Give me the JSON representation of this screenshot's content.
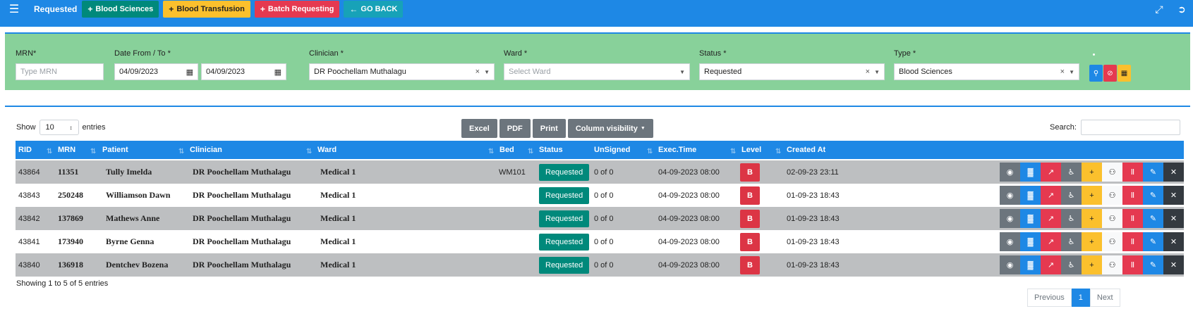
{
  "topbar": {
    "menu_icon": "hamburger-icon",
    "crumb": "Requested",
    "buttons": [
      {
        "label": "Blood Sciences",
        "icon": "plus-icon"
      },
      {
        "label": "Blood Transfusion",
        "icon": "plus-icon"
      },
      {
        "label": "Batch Requesting",
        "icon": "plus-icon"
      },
      {
        "label": "GO BACK",
        "icon": "arrow-left-icon"
      }
    ],
    "right_icons": [
      "expand-icon",
      "logout-icon"
    ]
  },
  "filters": {
    "mrn": {
      "label": "MRN*",
      "placeholder": "Type MRN"
    },
    "date": {
      "label": "Date From / To *",
      "from": "04/09/2023",
      "to": "04/09/2023"
    },
    "clinician": {
      "label": "Clinician *",
      "value": "DR Poochellam Muthalagu"
    },
    "ward": {
      "label": "Ward *",
      "placeholder": "Select Ward"
    },
    "status": {
      "label": "Status *",
      "value": "Requested"
    },
    "type": {
      "label": "Type *",
      "value": "Blood Sciences"
    },
    "action_colors": {
      "search": "#1e88e5",
      "clear": "#e53950",
      "calendar": "#fbc02d"
    }
  },
  "table": {
    "show_label": "Show",
    "entries_value": "10",
    "entries_label": "entries",
    "export_buttons": [
      "Excel",
      "PDF",
      "Print",
      "Column visibility"
    ],
    "search_label": "Search:",
    "columns": [
      "RID",
      "MRN",
      "Patient",
      "Clinician",
      "Ward",
      "Bed",
      "Status",
      "UnSigned",
      "Exec.Time",
      "Level",
      "Created At"
    ],
    "rows": [
      {
        "rid": "43864",
        "mrn": "11351",
        "patient": "Tully Imelda",
        "clinician": "DR Poochellam Muthalagu",
        "ward": "Medical 1",
        "bed": "WM101",
        "status": "Requested",
        "unsigned": "0 of 0",
        "exec": "04-09-2023 08:00",
        "level": "B",
        "created": "02-09-23 23:11"
      },
      {
        "rid": "43843",
        "mrn": "250248",
        "patient": "Williamson Dawn",
        "clinician": "DR Poochellam Muthalagu",
        "ward": "Medical 1",
        "bed": "",
        "status": "Requested",
        "unsigned": "0 of 0",
        "exec": "04-09-2023 08:00",
        "level": "B",
        "created": "01-09-23 18:43"
      },
      {
        "rid": "43842",
        "mrn": "137869",
        "patient": "Mathews Anne",
        "clinician": "DR Poochellam Muthalagu",
        "ward": "Medical 1",
        "bed": "",
        "status": "Requested",
        "unsigned": "0 of 0",
        "exec": "04-09-2023 08:00",
        "level": "B",
        "created": "01-09-23 18:43"
      },
      {
        "rid": "43841",
        "mrn": "173940",
        "patient": "Byrne Genna",
        "clinician": "DR Poochellam Muthalagu",
        "ward": "Medical 1",
        "bed": "",
        "status": "Requested",
        "unsigned": "0 of 0",
        "exec": "04-09-2023 08:00",
        "level": "B",
        "created": "01-09-23 18:43"
      },
      {
        "rid": "43840",
        "mrn": "136918",
        "patient": "Dentchev Bozena",
        "clinician": "DR Poochellam Muthalagu",
        "ward": "Medical 1",
        "bed": "",
        "status": "Requested",
        "unsigned": "0 of 0",
        "exec": "04-09-2023 08:00",
        "level": "B",
        "created": "01-09-23 18:43"
      }
    ],
    "row_actions": [
      {
        "icon": "eye-icon",
        "color": "#6c757d"
      },
      {
        "icon": "bar-chart-icon",
        "color": "#1e88e5"
      },
      {
        "icon": "line-chart-icon",
        "color": "#e53950"
      },
      {
        "icon": "wheelchair-icon",
        "color": "#6c757d"
      },
      {
        "icon": "plus-icon",
        "color": "#fbc02d"
      },
      {
        "icon": "users-icon",
        "color": "#f8f9fa"
      },
      {
        "icon": "bookmark-icon",
        "color": "#e53950"
      },
      {
        "icon": "edit-icon",
        "color": "#1e88e5"
      },
      {
        "icon": "close-icon",
        "color": "#343a40"
      }
    ],
    "info": "Showing 1 to 5 of 5 entries",
    "pager": {
      "previous": "Previous",
      "current": "1",
      "next": "Next"
    }
  }
}
